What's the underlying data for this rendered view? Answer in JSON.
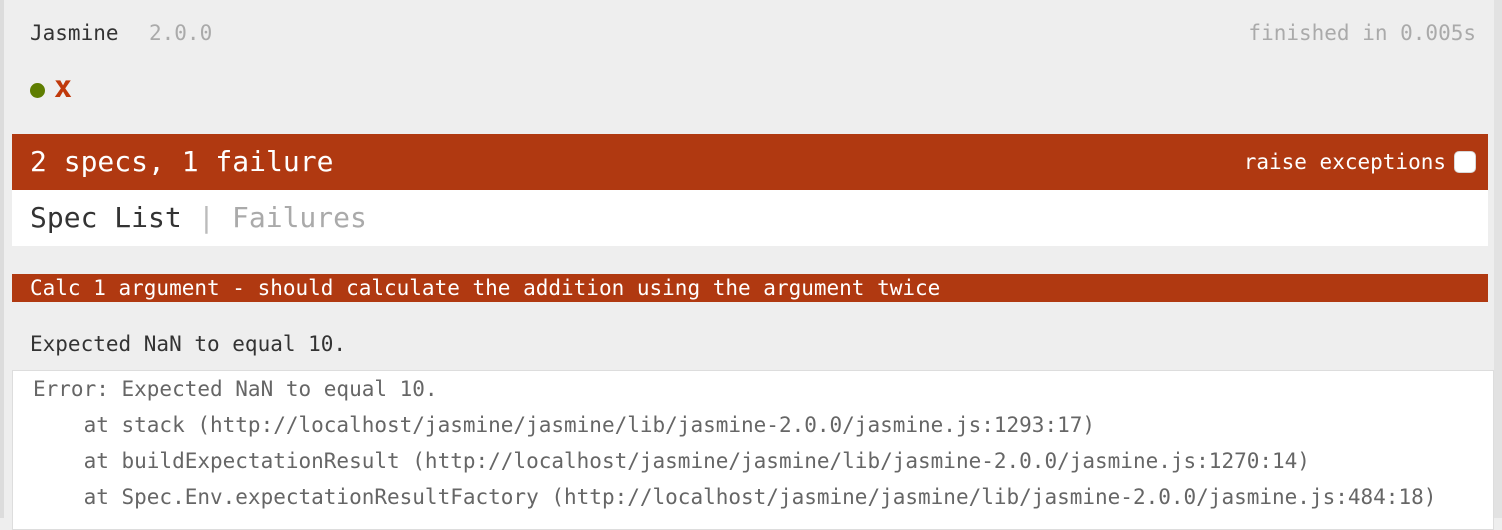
{
  "banner": {
    "title": "Jasmine",
    "version": "2.0.0",
    "duration": "finished in 0.005s"
  },
  "symbol_summary": {
    "items": [
      {
        "status": "passed",
        "glyph": "●",
        "color": "#5e7d00"
      },
      {
        "status": "failed",
        "glyph": "x",
        "color": "#c0390b"
      }
    ]
  },
  "alert": {
    "bar_text": "2 specs, 1 failure",
    "raise_exceptions_label": "raise exceptions",
    "raise_exceptions_checked": false,
    "color": "#b03911"
  },
  "menu": {
    "spec_list_label": "Spec List",
    "separator": "|",
    "failures_label": "Failures"
  },
  "failure": {
    "description": "Calc 1 argument - should calculate the addition using the argument twice",
    "message": "Expected NaN to equal 10.",
    "stack": [
      "Error: Expected NaN to equal 10.",
      "    at stack (http://localhost/jasmine/jasmine/lib/jasmine-2.0.0/jasmine.js:1293:17)",
      "    at buildExpectationResult (http://localhost/jasmine/jasmine/lib/jasmine-2.0.0/jasmine.js:1270:14)",
      "    at Spec.Env.expectationResultFactory (http://localhost/jasmine/jasmine/lib/jasmine-2.0.0/jasmine.js:484:18)"
    ]
  }
}
